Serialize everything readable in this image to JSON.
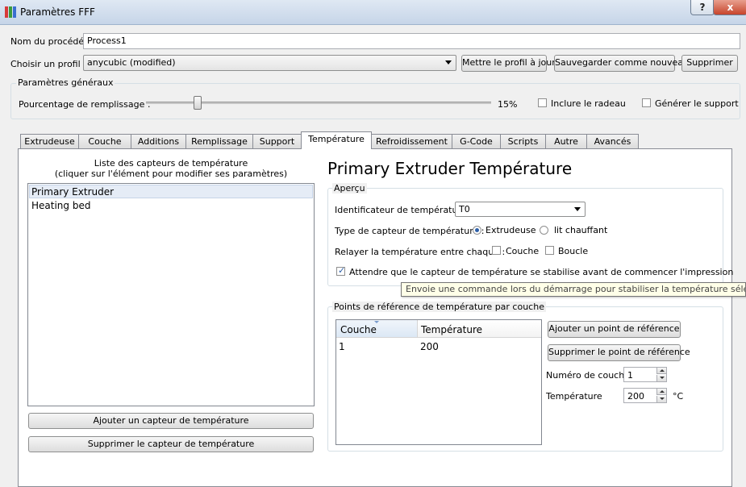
{
  "window": {
    "title": "Paramètres FFF",
    "help_label": "?",
    "close_label": "x"
  },
  "process": {
    "label": "Nom du procédé :",
    "value": "Process1"
  },
  "profile": {
    "label": "Choisir un profil :",
    "selected": "anycubic (modified)",
    "update_label": "Mettre le profil à jour",
    "save_label": "Sauvegarder comme nouveau",
    "delete_label": "Supprimer"
  },
  "general": {
    "title": "Paramètres généraux",
    "infill_label": "Pourcentage de remplissage :",
    "infill_value": "15%",
    "infill_fraction": 0.15,
    "raft_label": "Inclure le radeau",
    "raft_checked": false,
    "support_label": "Générer le support",
    "support_checked": false
  },
  "tabs": [
    {
      "label": "Extrudeuse",
      "active": false
    },
    {
      "label": "Couche",
      "active": false
    },
    {
      "label": "Additions",
      "active": false
    },
    {
      "label": "Remplissage",
      "active": false
    },
    {
      "label": "Support",
      "active": false
    },
    {
      "label": "Température",
      "active": true
    },
    {
      "label": "Refroidissement",
      "active": false
    },
    {
      "label": "G-Code",
      "active": false
    },
    {
      "label": "Scripts",
      "active": false
    },
    {
      "label": "Autre",
      "active": false
    },
    {
      "label": "Avancés",
      "active": false
    }
  ],
  "sensors": {
    "caption_line1": "Liste des capteurs de température",
    "caption_line2": "(cliquer sur l'élément pour modifier ses paramètres)",
    "items": [
      "Primary Extruder",
      "Heating bed"
    ],
    "selected_index": 0,
    "add_label": "Ajouter un capteur de température",
    "remove_label": "Supprimer le capteur de température"
  },
  "detail": {
    "heading": "Primary Extruder Température",
    "overview": {
      "title": "Aperçu",
      "identifier_label": "Identificateur de température",
      "identifier_value": "T0",
      "type_label": "Type de capteur de température :",
      "type_extruder": "Extrudeuse",
      "type_bed": "lit chauffant",
      "relay_label": "Relayer la température entre chaque :",
      "relay_layer": "Couche",
      "relay_loop": "Boucle",
      "wait_label": "Attendre que le capteur de température se stabilise avant de commencer l'impression",
      "wait_checked": true
    },
    "tooltip": "Envoie une commande lors du démarrage pour stabiliser la température sélectionnée",
    "points": {
      "title": "Points de référence de température par couche",
      "col_layer": "Couche",
      "col_temp": "Température",
      "rows": [
        {
          "layer": "1",
          "temp": "200"
        }
      ],
      "add_label": "Ajouter un point de référence",
      "remove_label": "Supprimer le point de référence",
      "layer_num_label": "Numéro de couche",
      "layer_num_value": "1",
      "temp_label": "Température",
      "temp_value": "200",
      "temp_unit": "°C"
    }
  },
  "colors": {
    "accent": "#2d5fa8",
    "selection": "#e5ecf6",
    "tooltip_bg": "#ffffe8"
  }
}
